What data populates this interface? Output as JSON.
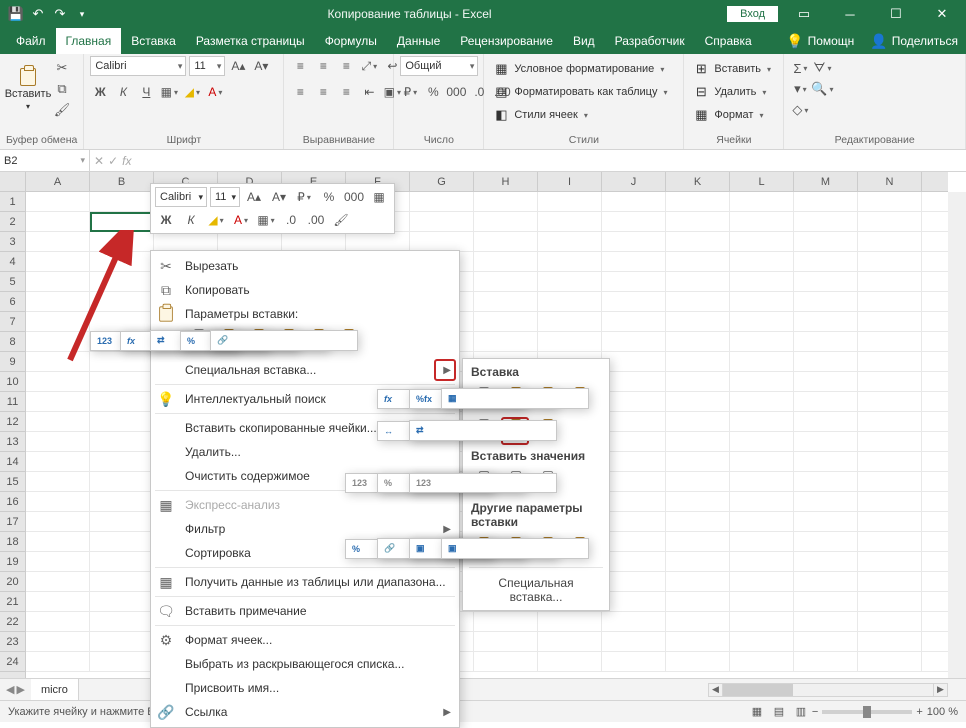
{
  "title": "Копирование таблицы  -  Excel",
  "login_btn": "Вход",
  "tabs": {
    "file": "Файл",
    "home": "Главная",
    "insert": "Вставка",
    "layout": "Разметка страницы",
    "formulas": "Формулы",
    "data": "Данные",
    "review": "Рецензирование",
    "view": "Вид",
    "dev": "Разработчик",
    "help": "Справка",
    "help2": "Помощн",
    "share": "Поделиться"
  },
  "ribbon": {
    "clipboard": {
      "label": "Буфер обмена",
      "paste": "Вставить"
    },
    "font": {
      "label": "Шрифт",
      "name": "Calibri",
      "size": "11"
    },
    "align": {
      "label": "Выравнивание"
    },
    "number": {
      "label": "Число",
      "fmt": "Общий"
    },
    "styles": {
      "label": "Стили",
      "cond": "Условное форматирование",
      "table": "Форматировать как таблицу",
      "cell": "Стили ячеек"
    },
    "cells": {
      "label": "Ячейки",
      "ins": "Вставить",
      "del": "Удалить",
      "fmt": "Формат"
    },
    "edit": {
      "label": "Редактирование"
    }
  },
  "namebox": "B2",
  "columns": [
    "A",
    "B",
    "C",
    "D",
    "E",
    "F",
    "G",
    "H",
    "I",
    "J",
    "K",
    "L",
    "M",
    "N"
  ],
  "minifont": "Calibri",
  "minisize": "11",
  "ctx": {
    "cut": "Вырезать",
    "copy": "Копировать",
    "pasteopts": "Параметры вставки:",
    "special": "Специальная вставка...",
    "smart": "Интеллектуальный поиск",
    "insertcells": "Вставить скопированные ячейки...",
    "delete": "Удалить...",
    "clear": "Очистить содержимое",
    "quick": "Экспресс-анализ",
    "filter": "Фильтр",
    "sort": "Сортировка",
    "gettable": "Получить данные из таблицы или диапазона...",
    "comment": "Вставить примечание",
    "fmtcells": "Формат ячеек...",
    "picklist": "Выбрать из раскрывающегося списка...",
    "name": "Присвоить имя...",
    "link": "Ссылка"
  },
  "sub": {
    "paste": "Вставка",
    "values": "Вставить значения",
    "other": "Другие параметры вставки",
    "special": "Специальная вставка..."
  },
  "sheet_tab": "micro",
  "statusmsg": "Укажите ячейку и нажмите ВВОД или выберите \"Вставить\"",
  "zoom": "100 %"
}
